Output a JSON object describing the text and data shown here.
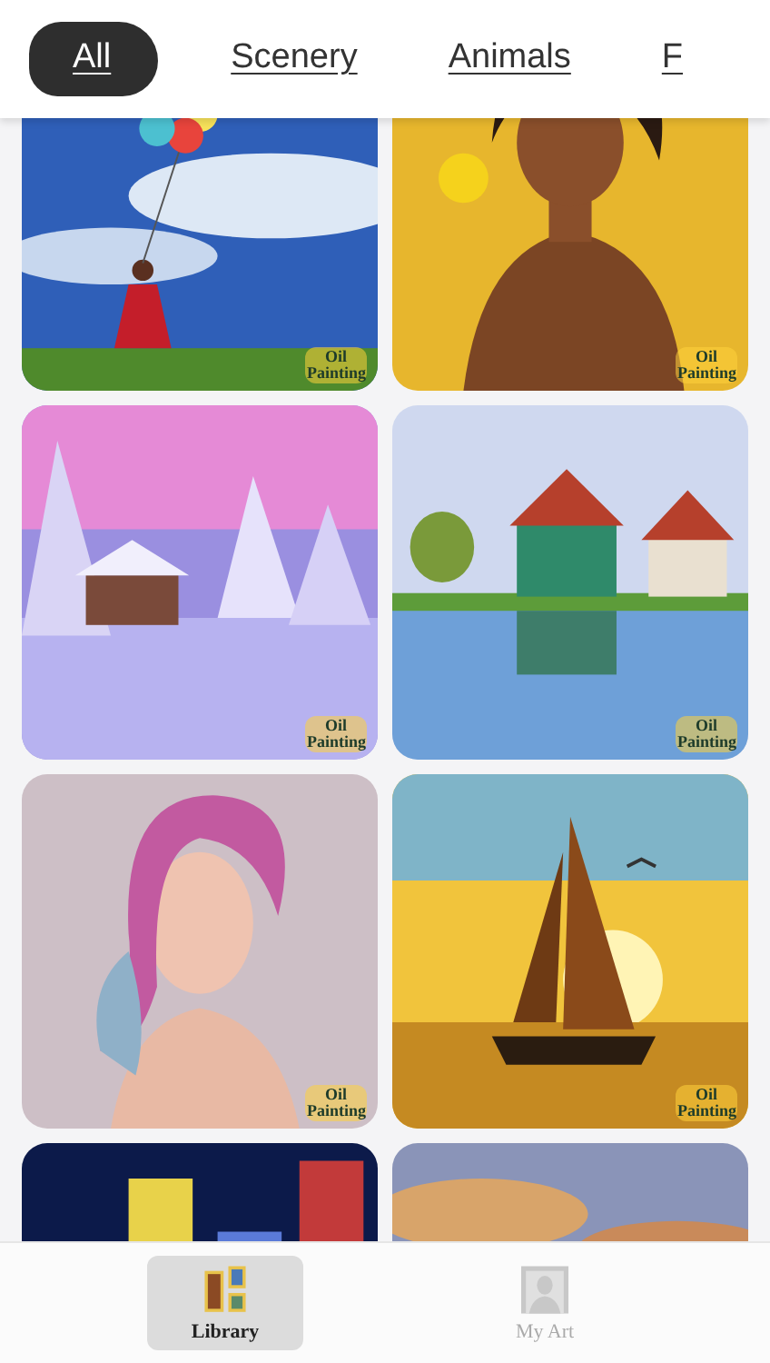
{
  "tabs": [
    {
      "label": "All",
      "selected": true
    },
    {
      "label": "Scenery",
      "selected": false
    },
    {
      "label": "Animals",
      "selected": false
    },
    {
      "label": "F",
      "selected": false
    }
  ],
  "gallery": [
    {
      "kind": "picture",
      "badge": "Oil Painting"
    },
    {
      "kind": "picture",
      "badge": "Oil Painting"
    },
    {
      "kind": "picture",
      "badge": "Oil Painting"
    },
    {
      "kind": "picture",
      "badge": "Oil Painting"
    },
    {
      "kind": "picture",
      "badge": "Oil Painting"
    },
    {
      "kind": "picture",
      "badge": "Oil Painting"
    },
    {
      "kind": "picture"
    },
    {
      "kind": "picture"
    }
  ],
  "bottom_nav": [
    {
      "label": "Library",
      "selected": true
    },
    {
      "label": "My Art",
      "selected": false
    }
  ]
}
